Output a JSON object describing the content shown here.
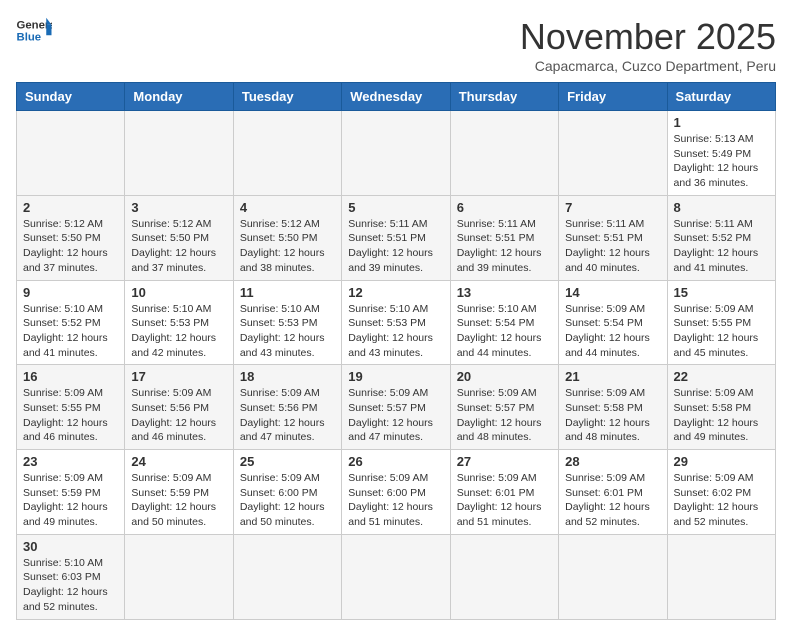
{
  "header": {
    "logo_general": "General",
    "logo_blue": "Blue",
    "title": "November 2025",
    "subtitle": "Capacmarca, Cuzco Department, Peru"
  },
  "weekdays": [
    "Sunday",
    "Monday",
    "Tuesday",
    "Wednesday",
    "Thursday",
    "Friday",
    "Saturday"
  ],
  "weeks": [
    [
      {
        "day": "",
        "info": ""
      },
      {
        "day": "",
        "info": ""
      },
      {
        "day": "",
        "info": ""
      },
      {
        "day": "",
        "info": ""
      },
      {
        "day": "",
        "info": ""
      },
      {
        "day": "",
        "info": ""
      },
      {
        "day": "1",
        "info": "Sunrise: 5:13 AM\nSunset: 5:49 PM\nDaylight: 12 hours\nand 36 minutes."
      }
    ],
    [
      {
        "day": "2",
        "info": "Sunrise: 5:12 AM\nSunset: 5:50 PM\nDaylight: 12 hours\nand 37 minutes."
      },
      {
        "day": "3",
        "info": "Sunrise: 5:12 AM\nSunset: 5:50 PM\nDaylight: 12 hours\nand 37 minutes."
      },
      {
        "day": "4",
        "info": "Sunrise: 5:12 AM\nSunset: 5:50 PM\nDaylight: 12 hours\nand 38 minutes."
      },
      {
        "day": "5",
        "info": "Sunrise: 5:11 AM\nSunset: 5:51 PM\nDaylight: 12 hours\nand 39 minutes."
      },
      {
        "day": "6",
        "info": "Sunrise: 5:11 AM\nSunset: 5:51 PM\nDaylight: 12 hours\nand 39 minutes."
      },
      {
        "day": "7",
        "info": "Sunrise: 5:11 AM\nSunset: 5:51 PM\nDaylight: 12 hours\nand 40 minutes."
      },
      {
        "day": "8",
        "info": "Sunrise: 5:11 AM\nSunset: 5:52 PM\nDaylight: 12 hours\nand 41 minutes."
      }
    ],
    [
      {
        "day": "9",
        "info": "Sunrise: 5:10 AM\nSunset: 5:52 PM\nDaylight: 12 hours\nand 41 minutes."
      },
      {
        "day": "10",
        "info": "Sunrise: 5:10 AM\nSunset: 5:53 PM\nDaylight: 12 hours\nand 42 minutes."
      },
      {
        "day": "11",
        "info": "Sunrise: 5:10 AM\nSunset: 5:53 PM\nDaylight: 12 hours\nand 43 minutes."
      },
      {
        "day": "12",
        "info": "Sunrise: 5:10 AM\nSunset: 5:53 PM\nDaylight: 12 hours\nand 43 minutes."
      },
      {
        "day": "13",
        "info": "Sunrise: 5:10 AM\nSunset: 5:54 PM\nDaylight: 12 hours\nand 44 minutes."
      },
      {
        "day": "14",
        "info": "Sunrise: 5:09 AM\nSunset: 5:54 PM\nDaylight: 12 hours\nand 44 minutes."
      },
      {
        "day": "15",
        "info": "Sunrise: 5:09 AM\nSunset: 5:55 PM\nDaylight: 12 hours\nand 45 minutes."
      }
    ],
    [
      {
        "day": "16",
        "info": "Sunrise: 5:09 AM\nSunset: 5:55 PM\nDaylight: 12 hours\nand 46 minutes."
      },
      {
        "day": "17",
        "info": "Sunrise: 5:09 AM\nSunset: 5:56 PM\nDaylight: 12 hours\nand 46 minutes."
      },
      {
        "day": "18",
        "info": "Sunrise: 5:09 AM\nSunset: 5:56 PM\nDaylight: 12 hours\nand 47 minutes."
      },
      {
        "day": "19",
        "info": "Sunrise: 5:09 AM\nSunset: 5:57 PM\nDaylight: 12 hours\nand 47 minutes."
      },
      {
        "day": "20",
        "info": "Sunrise: 5:09 AM\nSunset: 5:57 PM\nDaylight: 12 hours\nand 48 minutes."
      },
      {
        "day": "21",
        "info": "Sunrise: 5:09 AM\nSunset: 5:58 PM\nDaylight: 12 hours\nand 48 minutes."
      },
      {
        "day": "22",
        "info": "Sunrise: 5:09 AM\nSunset: 5:58 PM\nDaylight: 12 hours\nand 49 minutes."
      }
    ],
    [
      {
        "day": "23",
        "info": "Sunrise: 5:09 AM\nSunset: 5:59 PM\nDaylight: 12 hours\nand 49 minutes."
      },
      {
        "day": "24",
        "info": "Sunrise: 5:09 AM\nSunset: 5:59 PM\nDaylight: 12 hours\nand 50 minutes."
      },
      {
        "day": "25",
        "info": "Sunrise: 5:09 AM\nSunset: 6:00 PM\nDaylight: 12 hours\nand 50 minutes."
      },
      {
        "day": "26",
        "info": "Sunrise: 5:09 AM\nSunset: 6:00 PM\nDaylight: 12 hours\nand 51 minutes."
      },
      {
        "day": "27",
        "info": "Sunrise: 5:09 AM\nSunset: 6:01 PM\nDaylight: 12 hours\nand 51 minutes."
      },
      {
        "day": "28",
        "info": "Sunrise: 5:09 AM\nSunset: 6:01 PM\nDaylight: 12 hours\nand 52 minutes."
      },
      {
        "day": "29",
        "info": "Sunrise: 5:09 AM\nSunset: 6:02 PM\nDaylight: 12 hours\nand 52 minutes."
      }
    ],
    [
      {
        "day": "30",
        "info": "Sunrise: 5:10 AM\nSunset: 6:03 PM\nDaylight: 12 hours\nand 52 minutes."
      },
      {
        "day": "",
        "info": ""
      },
      {
        "day": "",
        "info": ""
      },
      {
        "day": "",
        "info": ""
      },
      {
        "day": "",
        "info": ""
      },
      {
        "day": "",
        "info": ""
      },
      {
        "day": "",
        "info": ""
      }
    ]
  ]
}
